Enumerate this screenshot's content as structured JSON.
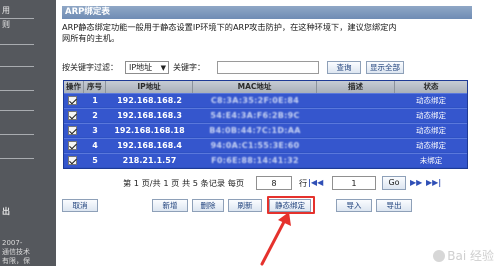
{
  "sidebar": {
    "items": [
      "用",
      "则",
      "",
      "",
      "",
      "",
      "出"
    ],
    "footer_1": "2007-",
    "footer_2": "通信技术",
    "footer_3": "有限，保"
  },
  "panel": {
    "title": "ARP绑定表",
    "description_line1": "ARP静态绑定功能一般用于静态设置IP环境下的ARP攻击防护，在这种环境下，建议您绑定内",
    "description_line2": "网所有的主机。"
  },
  "filter": {
    "label": "按关键字过滤：",
    "select_value": "IP地址",
    "keyword_label": "关键字：",
    "keyword_value": "",
    "search_button": "查询",
    "show_all_button": "显示全部"
  },
  "table": {
    "headers": [
      "操作",
      "序号",
      "IP地址",
      "MAC地址",
      "描述",
      "状态"
    ],
    "rows": [
      {
        "index": "1",
        "ip": "192.168.168.2",
        "mac": "C8:3A:35:2F:0E:84",
        "desc": "",
        "status": "动态绑定"
      },
      {
        "index": "2",
        "ip": "192.168.168.3",
        "mac": "54:E4:3A:F6:2B:9C",
        "desc": "",
        "status": "动态绑定"
      },
      {
        "index": "3",
        "ip": "192.168.168.18",
        "mac": "B4:0B:44:7C:1D:AA",
        "desc": "",
        "status": "动态绑定"
      },
      {
        "index": "4",
        "ip": "192.168.168.4",
        "mac": "94:0A:C1:55:3E:60",
        "desc": "",
        "status": "动态绑定"
      },
      {
        "index": "5",
        "ip": "218.21.1.57",
        "mac": "F0:6E:88:14:41:32",
        "desc": "",
        "status": "未绑定"
      }
    ]
  },
  "pager": {
    "summary": "第 1 页/共 1 页 共 5 条记录 每页",
    "per_page": "8",
    "row_unit": "行",
    "page": "1",
    "go": "Go"
  },
  "actions": {
    "cancel": "取消",
    "add": "新增",
    "delete": "删除",
    "refresh": "刷新",
    "static_bind": "静态绑定",
    "import": "导入",
    "export": "导出"
  },
  "watermark": "Bai  经验",
  "colors": {
    "table_row": "#3556cd",
    "highlight": "#e5322d",
    "sidebar": "#55585d"
  }
}
